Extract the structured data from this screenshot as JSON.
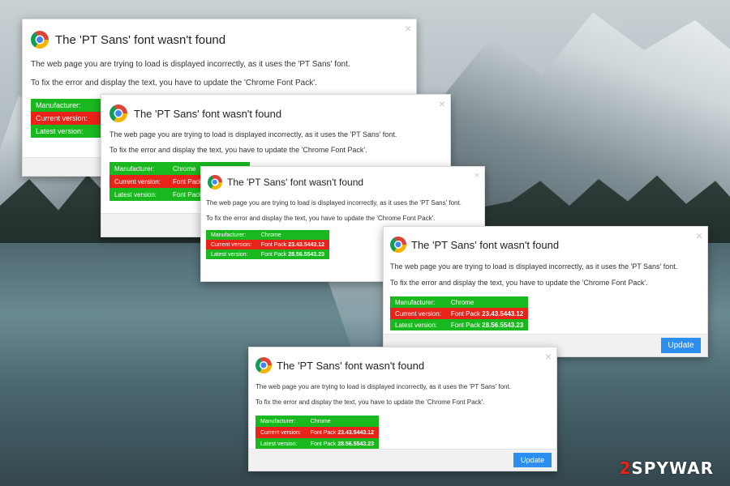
{
  "dialog": {
    "title": "The 'PT Sans' font wasn't found",
    "close_glyph": "×",
    "message_1": "The web page you are trying to load is displayed incorrectly, as it uses the 'PT Sans' font.",
    "message_2": "To fix the error and display the text, you have to update the 'Chrome Font Pack'.",
    "manufacturer_label": "Manufacturer:",
    "manufacturer_value": "Chrome",
    "current_label": "Current version:",
    "current_prefix": "Font Pack",
    "current_version": "23.43.5443.12",
    "latest_label": "Latest version:",
    "latest_prefix": "Font Pack",
    "latest_version": "28.56.5543.23",
    "update_label": "Update"
  },
  "watermark": {
    "prefix": "2",
    "text": "SPYWAR"
  },
  "colors": {
    "green_row": "#19b81f",
    "red_row": "#e8231a",
    "update_button": "#2c8ff0"
  },
  "icons": {
    "browser_logo": "chrome-logo-icon",
    "close": "close-icon"
  }
}
